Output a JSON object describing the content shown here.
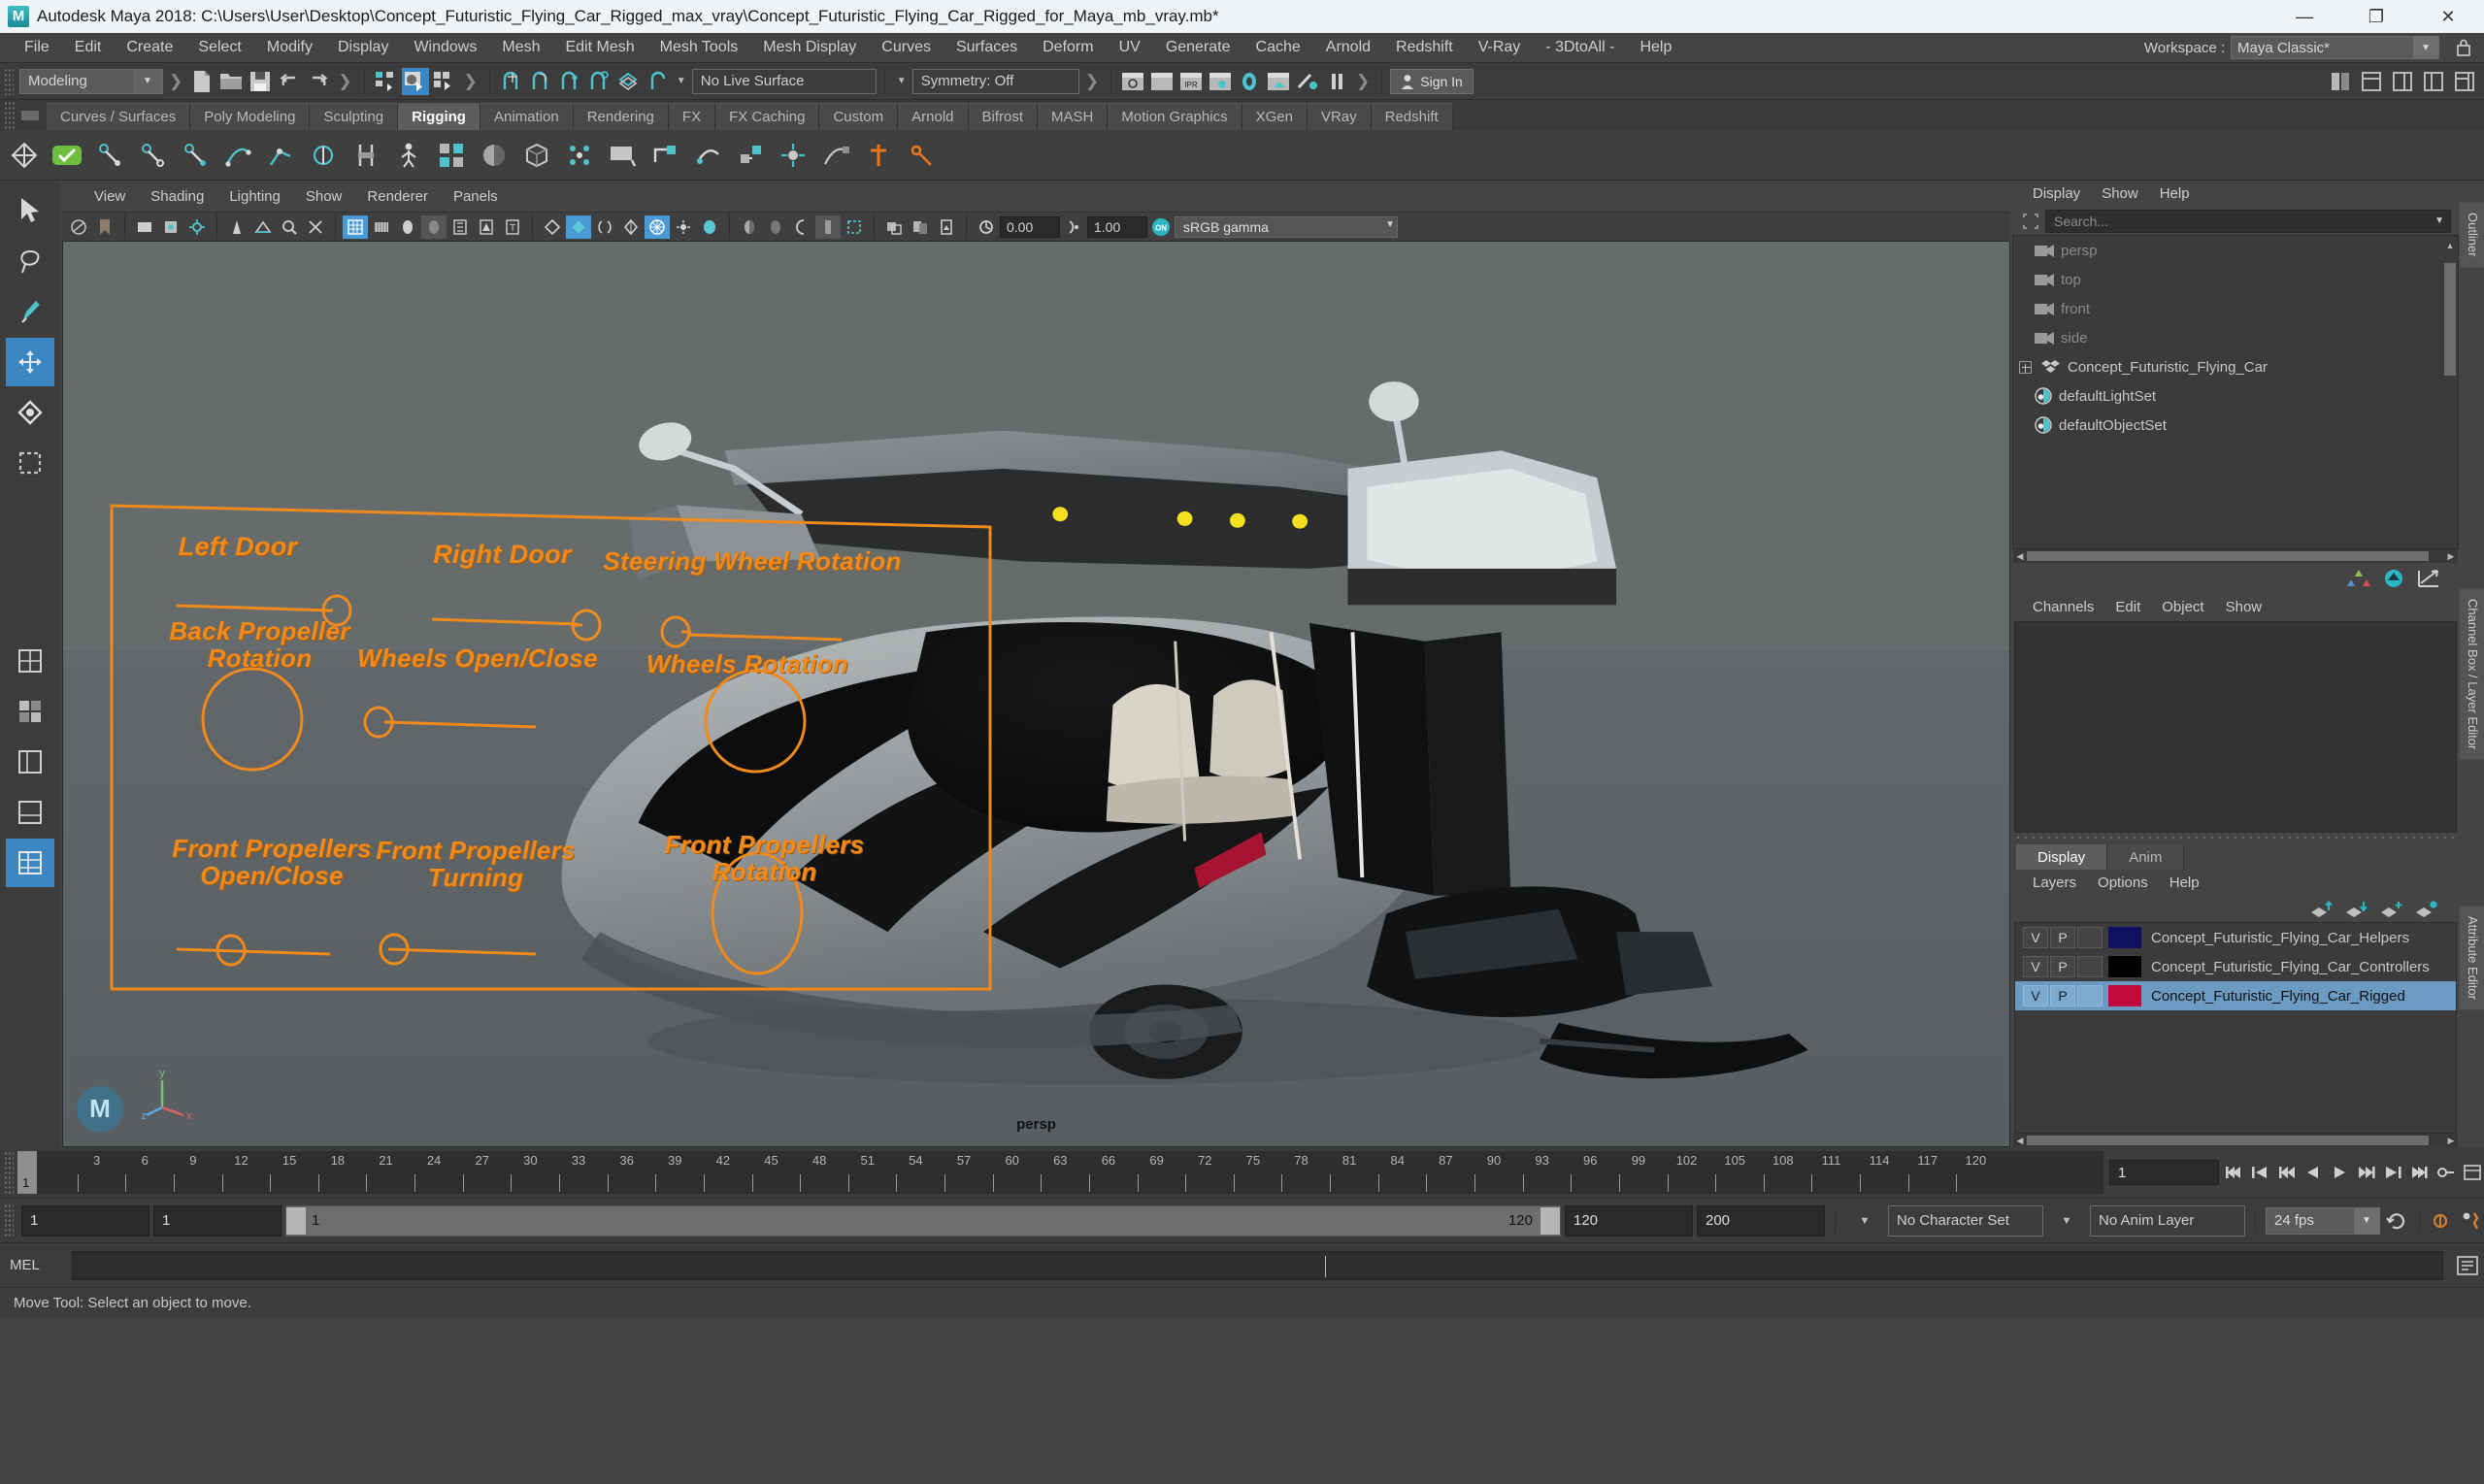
{
  "window": {
    "app_title": "Autodesk Maya 2018: C:\\Users\\User\\Desktop\\Concept_Futuristic_Flying_Car_Rigged_max_vray\\Concept_Futuristic_Flying_Car_Rigged_for_Maya_mb_vray.mb*",
    "minimize": "—",
    "maximize": "❐",
    "close": "✕"
  },
  "menubar": {
    "items": [
      "File",
      "Edit",
      "Create",
      "Select",
      "Modify",
      "Display",
      "Windows",
      "Mesh",
      "Edit Mesh",
      "Mesh Tools",
      "Mesh Display",
      "Curves",
      "Surfaces",
      "Deform",
      "UV",
      "Generate",
      "Cache",
      "Arnold",
      "Redshift",
      "V-Ray",
      "- 3DtoAll -",
      "Help"
    ],
    "workspace_label": "Workspace :",
    "workspace_value": "Maya Classic*"
  },
  "statusbar": {
    "mode": "Modeling",
    "live_surface": "No Live Surface",
    "symmetry": "Symmetry: Off",
    "signin": "Sign In"
  },
  "shelf": {
    "tabs": [
      "Curves / Surfaces",
      "Poly Modeling",
      "Sculpting",
      "Rigging",
      "Animation",
      "Rendering",
      "FX",
      "FX Caching",
      "Custom",
      "Arnold",
      "Bifrost",
      "MASH",
      "Motion Graphics",
      "XGen",
      "VRay",
      "Redshift"
    ],
    "active_tab": "Rigging"
  },
  "viewport": {
    "menus": [
      "View",
      "Shading",
      "Lighting",
      "Show",
      "Renderer",
      "Panels"
    ],
    "exposure": "0.00",
    "gamma": "1.00",
    "color_profile": "sRGB gamma",
    "camera_label": "persp",
    "axis": {
      "x": "x",
      "y": "y",
      "z": "z"
    },
    "accent_color": "#f08a1c",
    "controls": [
      {
        "label": "Left Door",
        "type": "slider"
      },
      {
        "label": "Right Door",
        "type": "slider"
      },
      {
        "label": "Steering Wheel Rotation",
        "type": "slider"
      },
      {
        "label": "Back Propeller\nRotation",
        "type": "dial"
      },
      {
        "label": "Wheels Open/Close",
        "type": "slider"
      },
      {
        "label": "Wheels Rotation",
        "type": "dial"
      },
      {
        "label": "Front Propellers\nOpen/Close",
        "type": "slider"
      },
      {
        "label": "Front Propellers\nTurning",
        "type": "slider"
      },
      {
        "label": "Front Propellers\nRotation",
        "type": "dial"
      }
    ]
  },
  "outliner": {
    "tab_label": "Outliner",
    "menus": [
      "Display",
      "Show",
      "Help"
    ],
    "search_placeholder": "Search...",
    "items": [
      {
        "label": "persp",
        "icon": "camera-icon",
        "dim": true
      },
      {
        "label": "top",
        "icon": "camera-icon",
        "dim": true
      },
      {
        "label": "front",
        "icon": "camera-icon",
        "dim": true
      },
      {
        "label": "side",
        "icon": "camera-icon",
        "dim": true
      },
      {
        "label": "Concept_Futuristic_Flying_Car",
        "icon": "group-icon",
        "dim": false,
        "expandable": true
      },
      {
        "label": "defaultLightSet",
        "icon": "set-icon",
        "dim": false
      },
      {
        "label": "defaultObjectSet",
        "icon": "set-icon",
        "dim": false
      }
    ]
  },
  "channelbox": {
    "tab_label": "Channel Box / Layer Editor",
    "attribute_tab_label": "Attribute Editor",
    "menus": [
      "Channels",
      "Edit",
      "Object",
      "Show"
    ]
  },
  "layers": {
    "tabs": [
      "Display",
      "Anim"
    ],
    "active_tab": "Display",
    "menus": [
      "Layers",
      "Options",
      "Help"
    ],
    "col_v": "V",
    "col_p": "P",
    "rows": [
      {
        "name": "Concept_Futuristic_Flying_Car_Helpers",
        "color": "#101060",
        "selected": false
      },
      {
        "name": "Concept_Futuristic_Flying_Car_Controllers",
        "color": "#000000",
        "selected": false
      },
      {
        "name": "Concept_Futuristic_Flying_Car_Rigged",
        "color": "#c10a3c",
        "selected": true
      }
    ]
  },
  "timeline": {
    "current_frame": "1",
    "ticks": [
      "3",
      "6",
      "9",
      "12",
      "15",
      "18",
      "21",
      "24",
      "27",
      "30",
      "33",
      "36",
      "39",
      "42",
      "45",
      "48",
      "51",
      "54",
      "57",
      "60",
      "63",
      "66",
      "69",
      "72",
      "75",
      "78",
      "81",
      "84",
      "87",
      "90",
      "93",
      "96",
      "99",
      "102",
      "105",
      "108",
      "111",
      "114",
      "117",
      "120"
    ],
    "frame_field": "1"
  },
  "rangebar": {
    "anim_start": "1",
    "range_start": "1",
    "slider_start": "1",
    "slider_end": "120",
    "range_end": "120",
    "anim_end": "200",
    "character_set": "No Character Set",
    "anim_layer": "No Anim Layer",
    "fps": "24 fps"
  },
  "mel": {
    "label": "MEL",
    "command": ""
  },
  "helpline": {
    "text": "Move Tool: Select an object to move."
  }
}
